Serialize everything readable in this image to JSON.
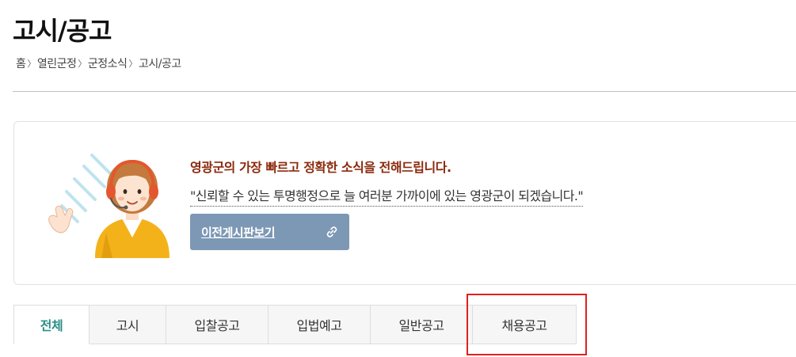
{
  "page": {
    "title": "고시/공고"
  },
  "breadcrumb": {
    "items": [
      "홈",
      "열린군정",
      "군정소식",
      "고시/공고"
    ],
    "separator": "〉"
  },
  "info": {
    "headline": "영광군의 가장 빠르고 정확한 소식을 전해드립니다.",
    "quote": "\"신뢰할 수 있는 투명행정으로 늘 여러분 가까이에 있는 영광군이 되겠습니다.\"",
    "prev_board_label": "이전게시판보기",
    "prev_board_icon": "link-icon"
  },
  "tabs": [
    {
      "label": "전체",
      "active": true
    },
    {
      "label": "고시",
      "active": false
    },
    {
      "label": "입찰공고",
      "active": false
    },
    {
      "label": "입법예고",
      "active": false
    },
    {
      "label": "일반공고",
      "active": false
    },
    {
      "label": "채용공고",
      "active": false
    }
  ],
  "colors": {
    "headline": "#8a2a0c",
    "button": "#7d98b5",
    "active_tab": "#2b8f87",
    "highlight": "#e02020"
  }
}
